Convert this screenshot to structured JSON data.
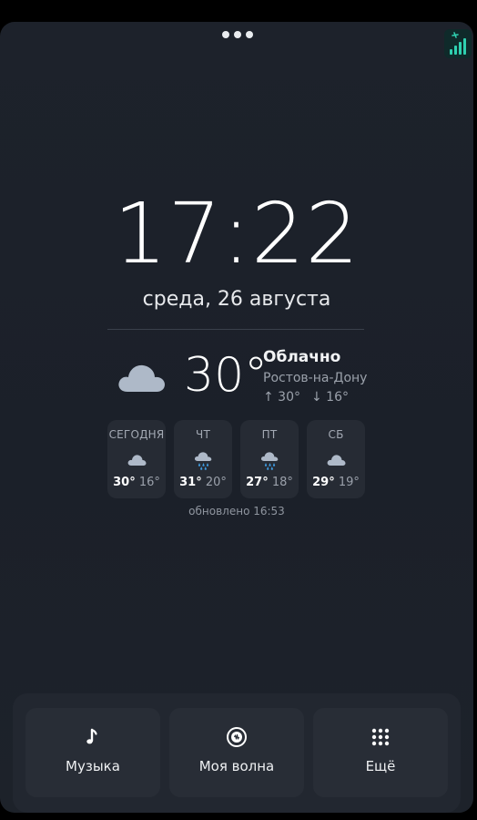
{
  "clock": {
    "time": "17:22",
    "date": "среда, 26 августа"
  },
  "weather": {
    "current_icon": "cloud-icon",
    "temperature": "30°",
    "condition": "Облачно",
    "city": "Ростов-на-Дону",
    "high": "↑ 30°",
    "low": "↓ 16°",
    "forecast": [
      {
        "day": "СЕГОДНЯ",
        "icon": "cloud-icon",
        "hi": "30°",
        "lo": "16°"
      },
      {
        "day": "ЧТ",
        "icon": "rain-icon",
        "hi": "31°",
        "lo": "20°"
      },
      {
        "day": "ПТ",
        "icon": "rain-icon",
        "hi": "27°",
        "lo": "18°"
      },
      {
        "day": "СБ",
        "icon": "cloud-icon",
        "hi": "29°",
        "lo": "19°"
      }
    ],
    "updated": "обновлено 16:53"
  },
  "dock": {
    "music_label": "Музыка",
    "wave_label": "Моя волна",
    "more_label": "Ещё"
  },
  "colors": {
    "background": "#1d222b",
    "card": "#262b34",
    "accent_signal": "#2fd0b0",
    "cloud": "#aeb9c8",
    "rain": "#3f9fe6"
  }
}
